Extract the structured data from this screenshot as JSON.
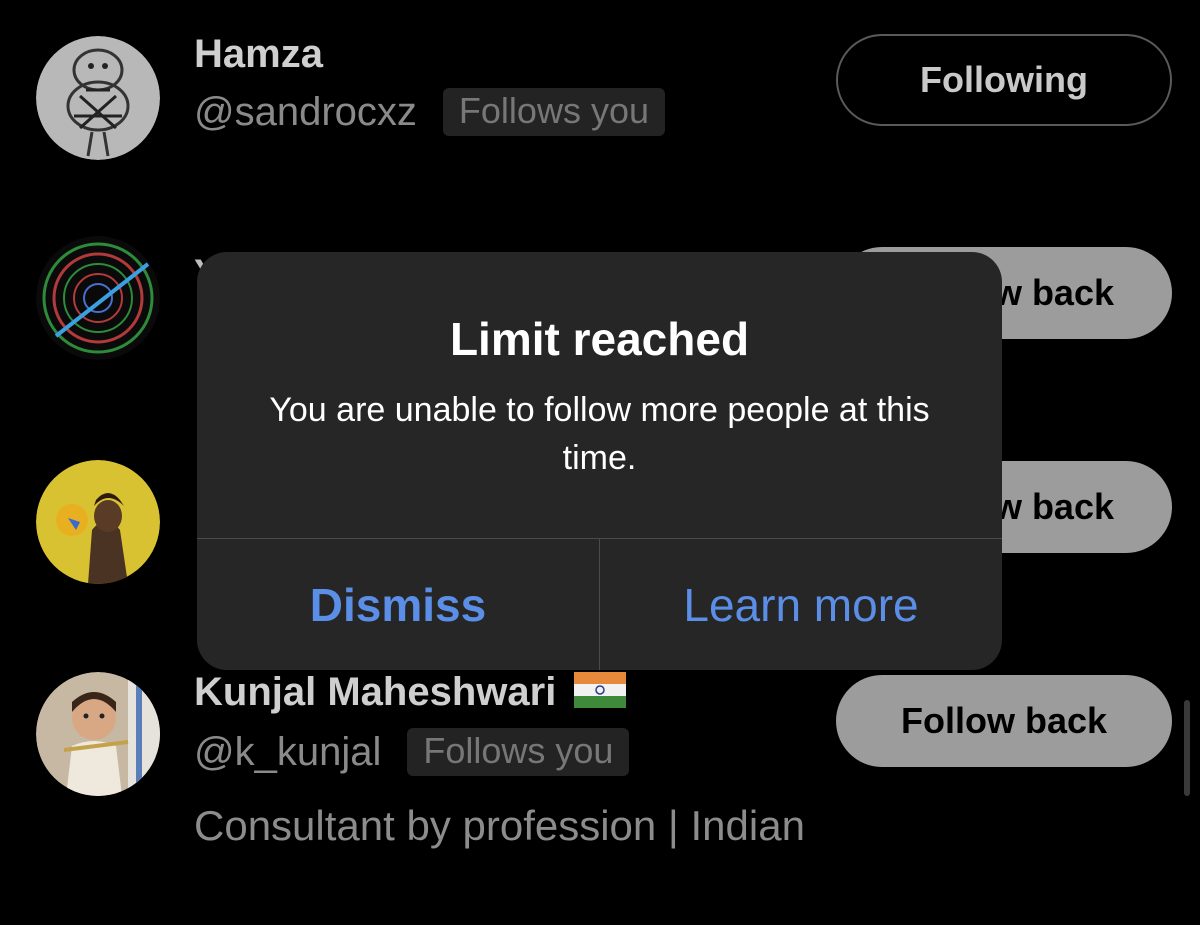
{
  "users": [
    {
      "name": "Hamza",
      "handle": "@sandrocxz",
      "badge": "Follows you",
      "button": "Following",
      "avatar_icon": "sketch-avatar-icon"
    },
    {
      "name_fragment": "Y",
      "button": "w back",
      "avatar_icon": "spiral-avatar-icon"
    },
    {
      "name_fragment": "",
      "button": "w back",
      "avatar_icon": "portrait-avatar-icon"
    },
    {
      "name": "Kunjal Maheshwari",
      "flag_icon": "india-flag-icon",
      "handle": "@k_kunjal",
      "badge": "Follows you",
      "bio": "Consultant by profession | Indian",
      "button": "Follow back",
      "avatar_icon": "child-avatar-icon"
    }
  ],
  "alert": {
    "title": "Limit reached",
    "message": "You are unable to follow more people at this time.",
    "dismiss_label": "Dismiss",
    "learn_more_label": "Learn more"
  },
  "colors": {
    "background": "#000000",
    "alert_background": "#262626",
    "alert_action": "#5b8ee6",
    "follow_back_button": "#9c9c9c"
  }
}
